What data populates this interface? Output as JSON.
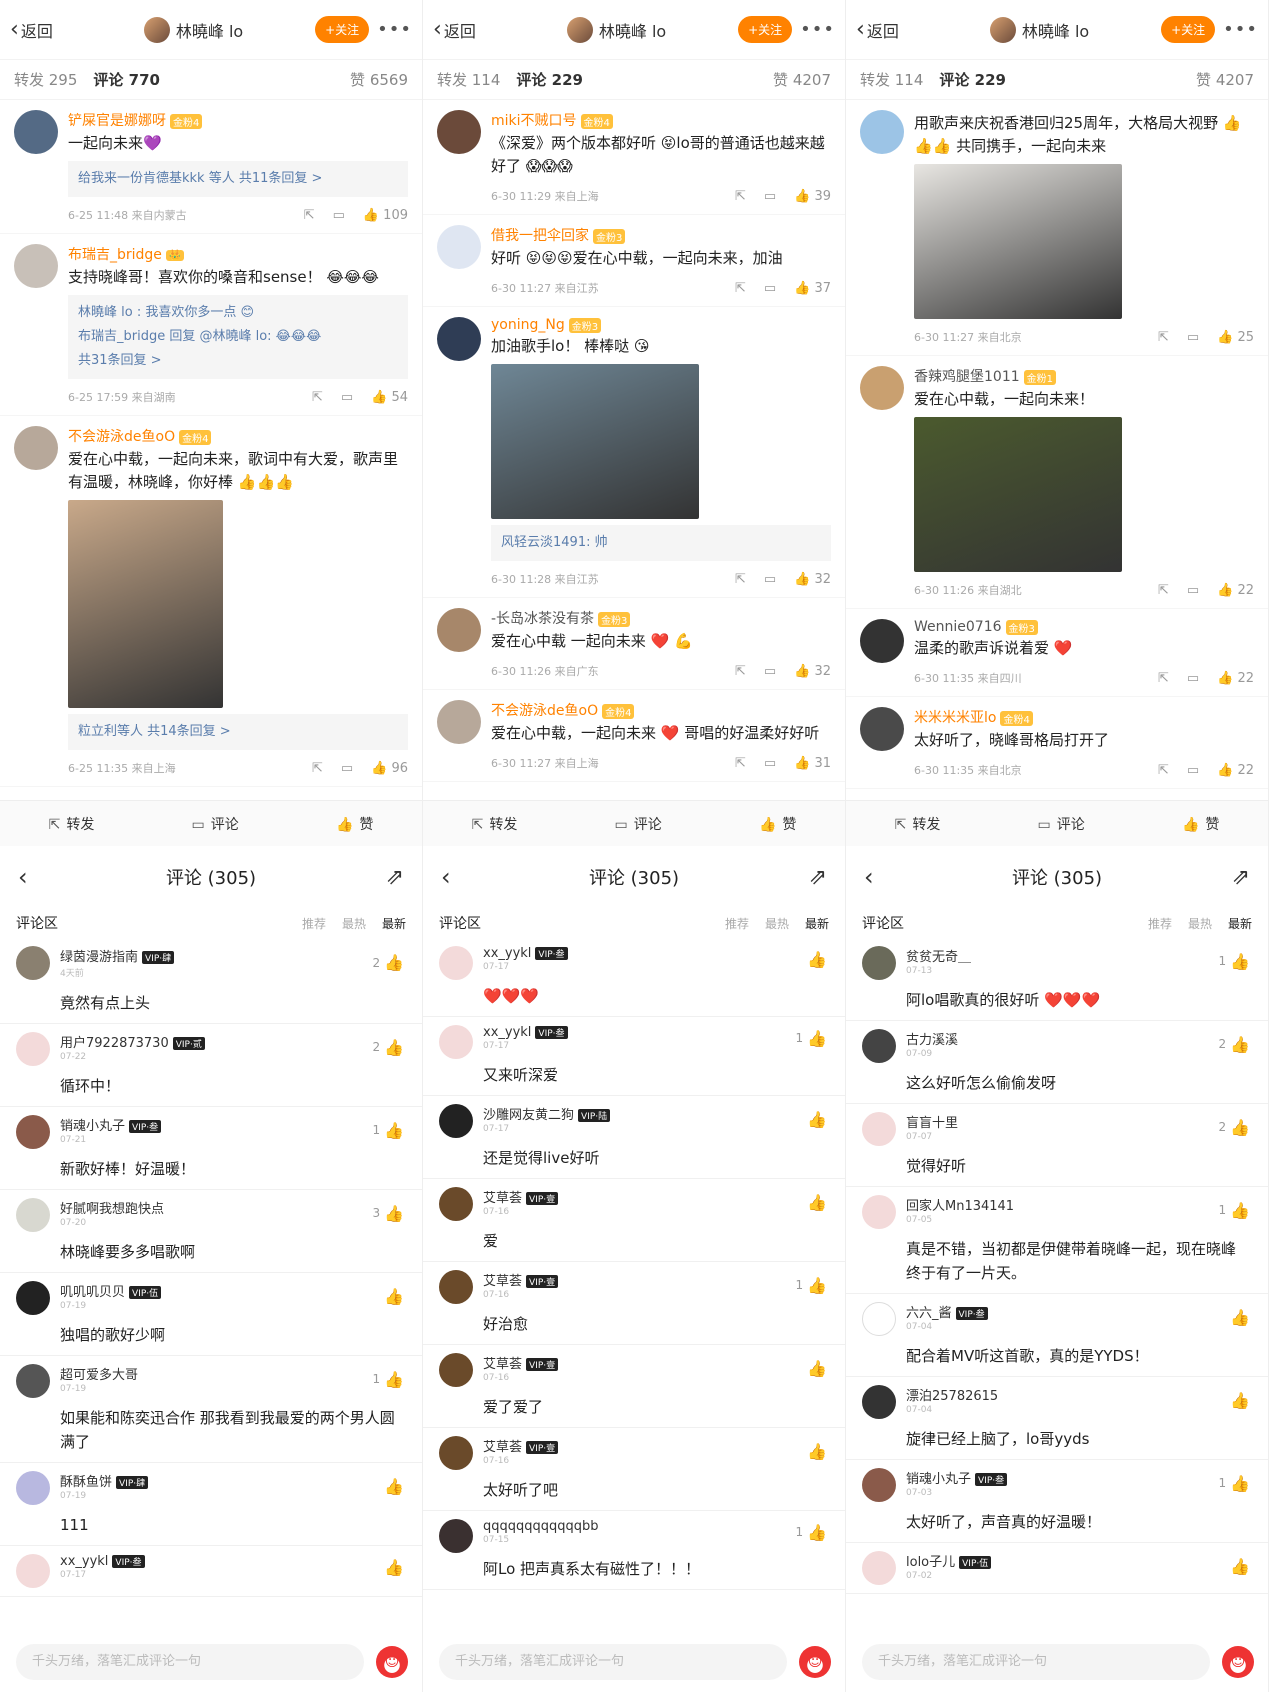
{
  "header": {
    "back": "返回",
    "user": "林曉峰 lo",
    "follow": "+关注",
    "more": "•••"
  },
  "top": [
    {
      "repost": "转发 295",
      "comment": "评论 770",
      "like": "赞 6569",
      "items": [
        {
          "name": "铲屎官是娜娜呀",
          "lv": "金粉4",
          "text": "一起向未来💜",
          "sub": [
            "给我来一份肯德基kkk 等人  共11条回复 >"
          ],
          "meta": "6-25 11:48  来自内蒙古",
          "likes": "109",
          "av": "#546a85"
        },
        {
          "name": "布瑞吉_bridge",
          "lv": "👑",
          "text": "支持晓峰哥！喜欢你的嗓音和sense！ 😂😂😂",
          "sub": [
            "林曉峰 lo : 我喜欢你多一点 😊",
            "布瑞吉_bridge 回复 @林曉峰 lo: 😂😂😂",
            "共31条回复 >"
          ],
          "meta": "6-25 17:59  来自湖南",
          "likes": "54",
          "av": "#c8c0b8"
        },
        {
          "name": "不会游泳de鱼oO",
          "lv": "金粉4",
          "text": "爱在心中载，一起向未来，歌词中有大爱，歌声里有温暖，林晓峰，你好棒 👍👍👍",
          "pic": "#c9a98a",
          "picw": 155,
          "pich": 208,
          "sub": [
            "粒立利等人  共14条回复 >"
          ],
          "meta": "6-25 11:35  来自上海",
          "likes": "96",
          "av": "#b7a89a"
        }
      ]
    },
    {
      "repost": "转发 114",
      "comment": "评论 229",
      "like": "赞 4207",
      "items": [
        {
          "name": "miki不贼口号",
          "lv": "金粉4",
          "text": "《深爱》两个版本都好听 😝lo哥的普通话也越来越好了 😱😱😱",
          "meta": "6-30 11:29  来自上海",
          "likes": "39",
          "av": "#6b4a3a"
        },
        {
          "name": "借我一把伞回家",
          "lv": "金粉3",
          "text": "好听 😝😝😝爱在心中载，一起向未来，加油",
          "meta": "6-30 11:27  来自江苏",
          "likes": "37",
          "av": "#dfe6f2"
        },
        {
          "name": "yoning_Ng",
          "lv": "金粉3",
          "text": "加油歌手lo！ 棒棒哒 😘",
          "pic": "#6f8796",
          "picw": 208,
          "pich": 155,
          "sub": [
            "风轻云淡1491: 帅"
          ],
          "meta": "6-30 11:28  来自江苏",
          "likes": "32",
          "av": "#2f3d55"
        },
        {
          "name": "-长岛冰茶没有茶",
          "lv": "金粉3",
          "gray": true,
          "text": "爱在心中载 一起向未来 ❤️ 💪",
          "meta": "6-30 11:26  来自广东",
          "likes": "32",
          "av": "#a7876a"
        },
        {
          "name": "不会游泳de鱼oO",
          "lv": "金粉4",
          "text": "爱在心中载，一起向未来 ❤️ 哥唱的好温柔好好听",
          "meta": "6-30 11:27  来自上海",
          "likes": "31",
          "av": "#b7a89a"
        }
      ]
    },
    {
      "repost": "转发 114",
      "comment": "评论 229",
      "like": "赞 4207",
      "items": [
        {
          "name": "",
          "lv": "",
          "text": "用歌声来庆祝香港回归25周年，大格局大视野 👍👍👍 共同携手，一起向未来",
          "pic": "#e8e6e2",
          "picw": 208,
          "pich": 155,
          "meta": "6-30 11:27  来自北京",
          "likes": "25",
          "av": "#9cc4e6"
        },
        {
          "name": "香辣鸡腿堡1011",
          "lv": "金粉1",
          "gray": true,
          "text": "爱在心中载，一起向未来！",
          "pic": "#4b5a2e",
          "picw": 208,
          "pich": 155,
          "meta": "6-30 11:26  来自湖北",
          "likes": "22",
          "av": "#c9a070"
        },
        {
          "name": "Wennie0716",
          "lv": "金粉3",
          "gray": true,
          "text": "温柔的歌声诉说着爱 ❤️",
          "meta": "6-30 11:35  来自四川",
          "likes": "22",
          "av": "#333"
        },
        {
          "name": "米米米米亚lo",
          "lv": "金粉4",
          "text": "太好听了，晓峰哥格局打开了",
          "meta": "6-30 11:35  来自北京",
          "likes": "22",
          "av": "#4a4a4a"
        }
      ]
    }
  ],
  "toolbar": {
    "repost": "转发",
    "comment": "评论",
    "like": "赞"
  },
  "bottom": {
    "title": "评论 (305)",
    "area": "评论区",
    "sort": [
      "推荐",
      "最热",
      "最新"
    ],
    "input": "千头万绪，落笔汇成评论一句",
    "panels": [
      [
        {
          "n": "绿茵漫游指南",
          "v": "VIP·肆",
          "d": "4天前",
          "t": "竟然有点上头",
          "l": "2",
          "av": "#8a8070"
        },
        {
          "n": "用户7922873730",
          "v": "VIP·贰",
          "d": "07-22",
          "t": "循环中！",
          "l": "2",
          "av": "#f3dada"
        },
        {
          "n": "销魂小丸子",
          "v": "VIP·叁",
          "d": "07-21",
          "t": "新歌好棒！好温暖！",
          "l": "1",
          "av": "#8a5a4a"
        },
        {
          "n": "好腻啊我想跑快点",
          "v": "",
          "d": "07-20",
          "t": "林晓峰要多多唱歌啊",
          "l": "3",
          "av": "#d8d8d0"
        },
        {
          "n": "叽叽叽贝贝",
          "v": "VIP·伍",
          "d": "07-19",
          "t": "独唱的歌好少啊",
          "l": "",
          "av": "#222"
        },
        {
          "n": "超可爱多大哥",
          "v": "",
          "d": "07-19",
          "t": "如果能和陈奕迅合作 那我看到我最爱的两个男人圆满了",
          "l": "1",
          "av": "#555"
        },
        {
          "n": "酥酥鱼饼",
          "v": "VIP·肆",
          "d": "07-19",
          "t": "111",
          "l": "",
          "av": "#b8b8e0"
        },
        {
          "n": "xx_yykl",
          "v": "VIP·叁",
          "d": "07-17",
          "t": "",
          "l": "",
          "av": "#f3dada"
        }
      ],
      [
        {
          "n": "xx_yykl",
          "v": "VIP·叁",
          "d": "07-17",
          "t": "❤️❤️❤️",
          "l": "",
          "av": "#f3dada"
        },
        {
          "n": "xx_yykl",
          "v": "VIP·叁",
          "d": "07-17",
          "t": "又来听深爱",
          "l": "1",
          "av": "#f3dada"
        },
        {
          "n": "沙雕网友黄二狗",
          "v": "VIP·陆",
          "d": "07-17",
          "t": "还是觉得live好听",
          "l": "",
          "av": "#222"
        },
        {
          "n": "艾草荟",
          "v": "VIP·壹",
          "d": "07-16",
          "t": "爱",
          "l": "",
          "av": "#6a4a2a"
        },
        {
          "n": "艾草荟",
          "v": "VIP·壹",
          "d": "07-16",
          "t": "好治愈",
          "l": "1",
          "av": "#6a4a2a"
        },
        {
          "n": "艾草荟",
          "v": "VIP·壹",
          "d": "07-16",
          "t": "爱了爱了",
          "l": "",
          "av": "#6a4a2a"
        },
        {
          "n": "艾草荟",
          "v": "VIP·壹",
          "d": "07-16",
          "t": "太好听了吧",
          "l": "",
          "av": "#6a4a2a"
        },
        {
          "n": "qqqqqqqqqqqqbb",
          "v": "",
          "d": "07-15",
          "t": "阿Lo 把声真系太有磁性了！！！",
          "l": "1",
          "av": "#3a3030"
        }
      ],
      [
        {
          "n": "贫贫无奇＿",
          "v": "",
          "d": "07-13",
          "t": "阿lo唱歌真的很好听 ❤️❤️❤️",
          "l": "1",
          "av": "#6a6a5a"
        },
        {
          "n": "古力溪溪",
          "v": "",
          "d": "07-09",
          "t": "这么好听怎么偷偷发呀",
          "l": "2",
          "av": "#444"
        },
        {
          "n": "盲盲十里",
          "v": "",
          "d": "07-07",
          "t": "觉得好听",
          "l": "2",
          "av": "#f3dada"
        },
        {
          "n": "回家人Mn134141",
          "v": "",
          "d": "07-05",
          "t": "真是不错，当初都是伊健带着晓峰一起，现在晓峰终于有了一片天。",
          "l": "1",
          "av": "#f3dada"
        },
        {
          "n": "六六_酱",
          "v": "VIP·叁",
          "d": "07-04",
          "t": "配合着MV听这首歌，真的是YYDS！",
          "l": "",
          "av": "#fff"
        },
        {
          "n": "漂泊25782615",
          "v": "",
          "d": "07-04",
          "t": "旋律已经上脑了，lo哥yyds",
          "l": "",
          "av": "#333"
        },
        {
          "n": "销魂小丸子",
          "v": "VIP·叁",
          "d": "07-03",
          "t": "太好听了，声音真的好温暖！",
          "l": "1",
          "av": "#8a5a4a"
        },
        {
          "n": "lolo子儿",
          "v": "VIP·伍",
          "d": "07-02",
          "t": "",
          "l": "",
          "av": "#f3dada"
        }
      ]
    ]
  }
}
